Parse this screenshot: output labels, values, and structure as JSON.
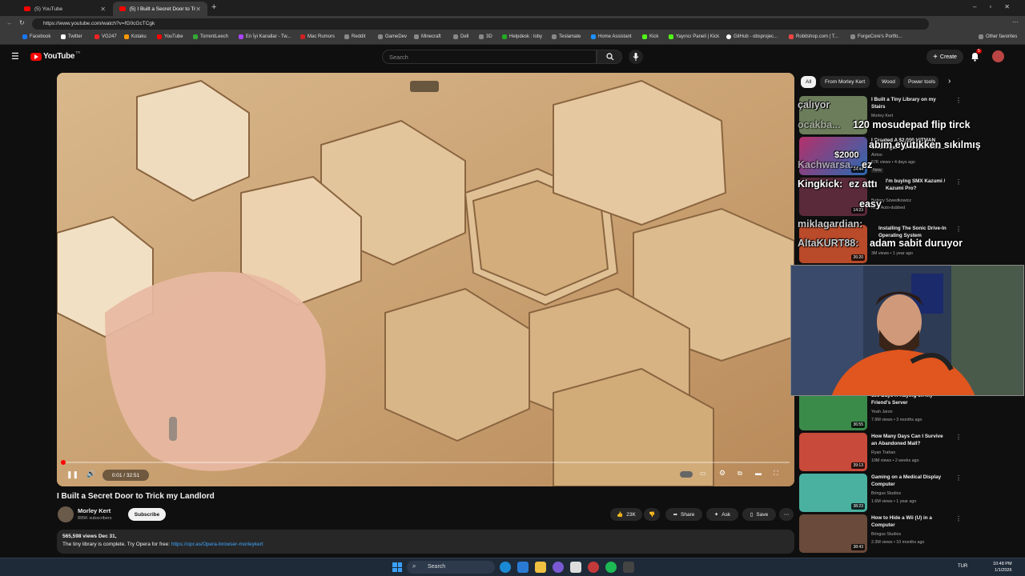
{
  "browser": {
    "tabs": [
      {
        "label": "(5) YouTube",
        "active": false
      },
      {
        "label": "(5) I Built a Secret Door to Tric",
        "active": true
      }
    ],
    "url": "https://www.youtube.com/watch?v=fG0cGcTCgk",
    "bookmarks": [
      "Facebook",
      "Twitter",
      "VG247",
      "Kotaku",
      "YouTube",
      "TorrentLeech",
      "En İyi Kanallar - Tw...",
      "Mac Rumors",
      "Reddit",
      "GameDev",
      "Minecraft",
      "Dell",
      "3D",
      "Helpdesk : loby",
      "Teslamate",
      "Home Assistant",
      "Kick",
      "Yayıncı Paneli | Kick",
      "GitHub - obsprojec...",
      "Robitshop.com | T...",
      "ForgeCore's Portfo...",
      "Other favorites"
    ]
  },
  "youtube": {
    "logo": "YouTube",
    "logo_region": "TR",
    "search_placeholder": "Search",
    "create_label": "Create",
    "notif_count": "5"
  },
  "player": {
    "time": "0:01 / 32:51",
    "progress_fraction": 0.0005
  },
  "video": {
    "title": "I Built a Secret Door to Trick my Landlord",
    "channel": "Morley Kert",
    "subscribers": "895K subscribers",
    "subscribe_label": "Subscribe",
    "likes": "23K",
    "share_label": "Share",
    "ask_label": "Ask",
    "save_label": "Save",
    "views_date": "565,598 views  Dec 31,",
    "description_text": "The tiny library is complete. Try Opera for free: ",
    "description_link": "https://opr.as/Opera-browser-morleykert"
  },
  "chips": [
    "All",
    "From Morley Kert",
    "Wood",
    "Power tools"
  ],
  "recommendations": [
    {
      "title": "I Built a Tiny Library on my Stairs",
      "channel": "Morley Kert",
      "meta": "",
      "duration": "",
      "color": "#6b7d5a"
    },
    {
      "title": "I Created A $2,000 HITMAN Challenge. The Results Were...",
      "channel": "Airtoo",
      "meta": "67K views • 4 days ago",
      "duration": "24:44",
      "badge": "New",
      "color": "#b3306a"
    },
    {
      "title": "I'm buying SMX Kazumi / Kazumi Pro?",
      "channel": "Battery Szwedkowicz",
      "meta": "New  Auto-dubbed",
      "duration": "14:23",
      "color": "#5a2a3a"
    },
    {
      "title": "Installing The Sonic Drive-In Operating System",
      "channel": "",
      "meta": "3M views • 1 year ago",
      "duration": "26:20",
      "color": "#b94a2a"
    },
    {
      "title": "100 Days X-Raying on my Friend's Server",
      "channel": "Yeah Jaron",
      "meta": "7.9M views • 3 months ago",
      "duration": "36:55",
      "color": "#3a8a4a"
    },
    {
      "title": "How Many Days Can I Survive an Abandoned Mall?",
      "channel": "Ryan Trahan",
      "meta": "10M views • 2 weeks ago",
      "duration": "39:13",
      "color": "#c84a3a"
    },
    {
      "title": "Gaming on a Medical Display Computer",
      "channel": "Bringus Studios",
      "meta": "1.6M views • 1 year ago",
      "duration": "38:23",
      "color": "#4ab0a0"
    },
    {
      "title": "How to Hide a Wii (U) in a Computer",
      "channel": "Bringus Studios",
      "meta": "2.3M views • 10 months ago",
      "duration": "38:43",
      "color": "#6a4a3a"
    }
  ],
  "stream_chat": [
    {
      "user": "çalıyor",
      "text": ""
    },
    {
      "user": "ocakba...",
      "text": "120 mosudepad flip tirck"
    },
    {
      "user": "",
      "text": "$2000"
    },
    {
      "user": "",
      "text": "abim eyütikken sıkılmış"
    },
    {
      "user": "Kachwarsa...",
      "text": "ez"
    },
    {
      "user": "Kingkick:",
      "text": "ez attı"
    },
    {
      "user": "",
      "text": "easy"
    },
    {
      "user": "miklagardian:",
      "text": ""
    },
    {
      "user": "AltaKURT88:",
      "text": "adam sabit duruyor"
    }
  ],
  "taskbar": {
    "search_label": "Search",
    "lang": "TUR",
    "time": "10:48 PM",
    "date": "1/1/2026"
  }
}
